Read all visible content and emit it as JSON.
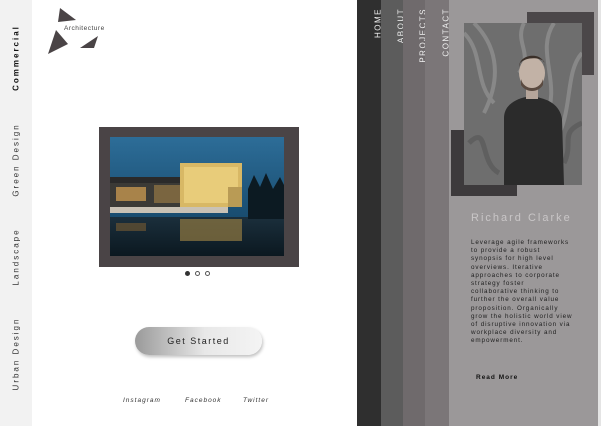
{
  "categories": [
    {
      "label": "Commercial",
      "active": true
    },
    {
      "label": "Green Design",
      "active": false
    },
    {
      "label": "Landscape",
      "active": false
    },
    {
      "label": "Urban Design",
      "active": false
    }
  ],
  "logo": {
    "text": "Architecture"
  },
  "slideshow": {
    "slide_count": 3,
    "active_slide": 1
  },
  "cta": {
    "label": "Get Started"
  },
  "social": [
    "Instagram",
    "Facebook",
    "Twitter"
  ],
  "nav": [
    "HOME",
    "ABOUT",
    "PROJECTS",
    "CONTACT"
  ],
  "profile": {
    "name": "Richard Clarke",
    "bio": "Leverage agile frameworks to provide a robust synopsis for high level overviews. Iterative approaches to corporate strategy foster collaborative thinking to further the overall value proposition. Organically grow the holistic world view of disruptive innovation via workplace diversity and empowerment.",
    "read_more": "Read More"
  },
  "colors": {
    "panel": "#9b9899",
    "dark": "#2f2f2f",
    "accent_sky": "#1f5f8a"
  }
}
